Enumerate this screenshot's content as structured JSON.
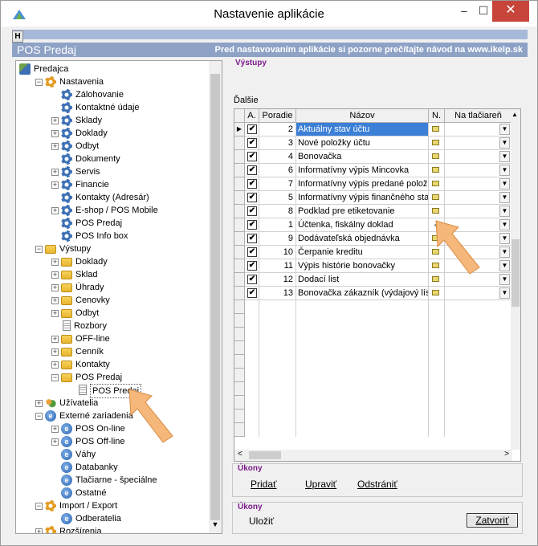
{
  "window": {
    "title": "Nastavenie aplikácie",
    "min": "–",
    "max": "☐",
    "close": "✕"
  },
  "h_button": "H",
  "banner": {
    "left": "POS Predaj",
    "right": "Pred nastavovaním aplikácie si pozorne prečítajte návod na www.ikelp.sk"
  },
  "tree": {
    "items": [
      {
        "label": "Predajca",
        "icon": "root-icon",
        "level": 0,
        "exp": ""
      },
      {
        "label": "Nastavenia",
        "icon": "gear-orange-icon",
        "level": 1,
        "exp": "−"
      },
      {
        "label": "Zálohovanie",
        "icon": "gear-icon",
        "level": 2,
        "exp": ""
      },
      {
        "label": "Kontaktné údaje",
        "icon": "gear-icon",
        "level": 2,
        "exp": ""
      },
      {
        "label": "Sklady",
        "icon": "gear-icon",
        "level": 2,
        "exp": "+"
      },
      {
        "label": "Doklady",
        "icon": "gear-icon",
        "level": 2,
        "exp": "+"
      },
      {
        "label": "Odbyt",
        "icon": "gear-icon",
        "level": 2,
        "exp": "+"
      },
      {
        "label": "Dokumenty",
        "icon": "gear-icon",
        "level": 2,
        "exp": ""
      },
      {
        "label": "Servis",
        "icon": "gear-icon",
        "level": 2,
        "exp": "+"
      },
      {
        "label": "Financie",
        "icon": "gear-icon",
        "level": 2,
        "exp": "+"
      },
      {
        "label": "Kontakty (Adresár)",
        "icon": "gear-icon",
        "level": 2,
        "exp": ""
      },
      {
        "label": "E-shop / POS Mobile",
        "icon": "gear-icon",
        "level": 2,
        "exp": "+"
      },
      {
        "label": "POS Predaj",
        "icon": "gear-icon",
        "level": 2,
        "exp": ""
      },
      {
        "label": "POS Info box",
        "icon": "gear-icon",
        "level": 2,
        "exp": ""
      },
      {
        "label": "Výstupy",
        "icon": "folder-open-icon",
        "level": 1,
        "exp": "−"
      },
      {
        "label": "Doklady",
        "icon": "folder-icon",
        "level": 2,
        "exp": "+"
      },
      {
        "label": "Sklad",
        "icon": "folder-icon",
        "level": 2,
        "exp": "+"
      },
      {
        "label": "Úhrady",
        "icon": "folder-icon",
        "level": 2,
        "exp": "+"
      },
      {
        "label": "Cenovky",
        "icon": "folder-icon",
        "level": 2,
        "exp": "+"
      },
      {
        "label": "Odbyt",
        "icon": "folder-icon",
        "level": 2,
        "exp": "+"
      },
      {
        "label": "Rozbory",
        "icon": "document-icon",
        "level": 2,
        "exp": ""
      },
      {
        "label": "OFF-line",
        "icon": "folder-icon",
        "level": 2,
        "exp": "+"
      },
      {
        "label": "Cenník",
        "icon": "folder-icon",
        "level": 2,
        "exp": "+"
      },
      {
        "label": "Kontakty",
        "icon": "folder-icon",
        "level": 2,
        "exp": "+"
      },
      {
        "label": "POS Predaj",
        "icon": "folder-open-icon",
        "level": 2,
        "exp": "−"
      },
      {
        "label": "POS Predaj",
        "icon": "document-icon",
        "level": 3,
        "exp": "",
        "selected": true
      },
      {
        "label": "Užívatelia",
        "icon": "users-icon",
        "level": 1,
        "exp": "+"
      },
      {
        "label": "Externé zariadenia",
        "icon": "device-icon",
        "level": 1,
        "exp": "−"
      },
      {
        "label": "POS On-line",
        "icon": "device-icon",
        "level": 2,
        "exp": "+"
      },
      {
        "label": "POS Off-line",
        "icon": "device-icon",
        "level": 2,
        "exp": "+"
      },
      {
        "label": "Váhy",
        "icon": "device-icon",
        "level": 2,
        "exp": ""
      },
      {
        "label": "Databanky",
        "icon": "device-icon",
        "level": 2,
        "exp": ""
      },
      {
        "label": "Tlačiarne - špeciálne",
        "icon": "device-icon",
        "level": 2,
        "exp": ""
      },
      {
        "label": "Ostatné",
        "icon": "device-icon",
        "level": 2,
        "exp": ""
      },
      {
        "label": "Import / Export",
        "icon": "gear-orange-icon",
        "level": 1,
        "exp": "−"
      },
      {
        "label": "Odberatelia",
        "icon": "device-icon",
        "level": 2,
        "exp": ""
      },
      {
        "label": "Rozšírenia",
        "icon": "gear-orange-icon",
        "level": 1,
        "exp": "+"
      }
    ]
  },
  "vystupy_group": "Výstupy",
  "dalsie_label": "Ďalšie",
  "grid": {
    "columns": [
      "A.",
      "Poradie",
      "Názov",
      "N.",
      "Na tlačiareň"
    ],
    "rows": [
      {
        "checked": "✔",
        "poradie": "2",
        "nazov": "Aktuálny stav účtu",
        "icon": "report",
        "selected": true
      },
      {
        "checked": "✔",
        "poradie": "3",
        "nazov": "Nové položky účtu",
        "icon": "report"
      },
      {
        "checked": "✔",
        "poradie": "4",
        "nazov": "Bonovačka",
        "icon": "report"
      },
      {
        "checked": "✔",
        "poradie": "6",
        "nazov": "Informatívny výpis Mincovka",
        "icon": "report"
      },
      {
        "checked": "✔",
        "poradie": "7",
        "nazov": "Informatívny výpis predané polož",
        "icon": "report"
      },
      {
        "checked": "✔",
        "poradie": "5",
        "nazov": "Informatívny výpis finančného sta",
        "icon": "report"
      },
      {
        "checked": "✔",
        "poradie": "8",
        "nazov": "Podklad pre etiketovanie",
        "icon": "report"
      },
      {
        "checked": "✔",
        "poradie": "1",
        "nazov": "Účtenka, fiskálny doklad",
        "icon": "dot"
      },
      {
        "checked": "✔",
        "poradie": "9",
        "nazov": "Dodávateľská objednávka",
        "icon": "report"
      },
      {
        "checked": "✔",
        "poradie": "10",
        "nazov": "Čerpanie kreditu",
        "icon": "report"
      },
      {
        "checked": "✔",
        "poradie": "11",
        "nazov": "Výpis histórie bonovačky",
        "icon": "report"
      },
      {
        "checked": "✔",
        "poradie": "12",
        "nazov": "Dodací list",
        "icon": "report"
      },
      {
        "checked": "✔",
        "poradie": "13",
        "nazov": "Bonovačka zákazník (výdajový lís",
        "icon": "report"
      }
    ]
  },
  "ukony1": {
    "title": "Úkony",
    "pridat": "Pridať",
    "upravit": "Upraviť",
    "odstranit": "Odstrániť"
  },
  "ukony2": {
    "title": "Úkony",
    "ulozit": "Uložiť",
    "zatvorit": "Zatvoriť"
  },
  "colors": {
    "banner": "#8ea2c6",
    "selection": "#3c7fd6",
    "group_title": "#7a1a8a",
    "arrow": "#f5b77a"
  }
}
